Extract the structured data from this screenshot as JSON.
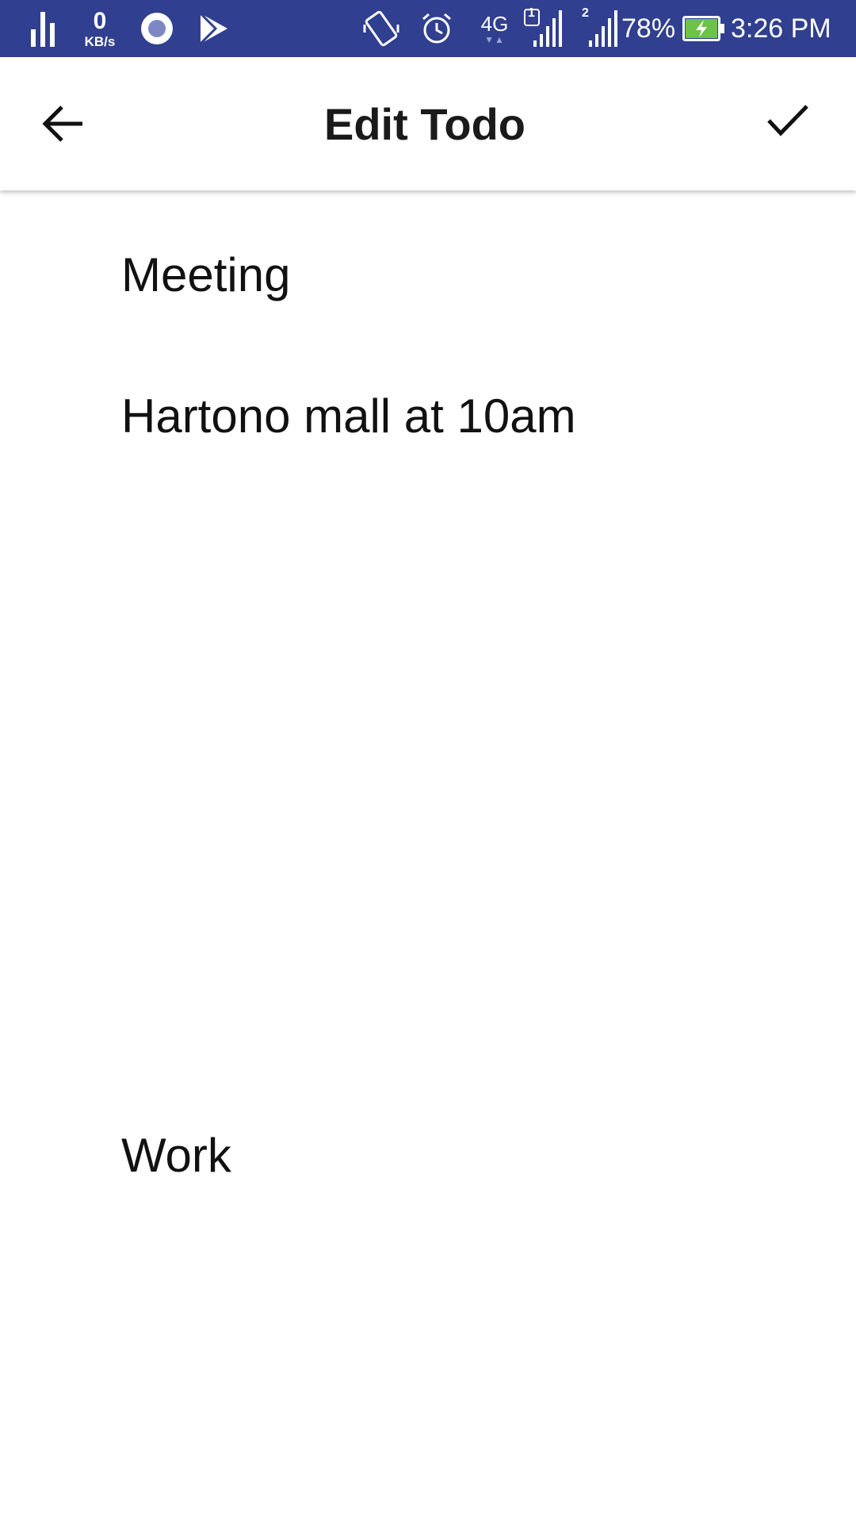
{
  "status_bar": {
    "data_speed_value": "0",
    "data_speed_unit": "KB/s",
    "network_type": "4G",
    "sim1_label": "1",
    "sim2_label": "2",
    "battery_percent": "78%",
    "time": "3:26 PM",
    "background_color": "#303f8f",
    "icons": [
      "signal-bars-icon",
      "circle-app-icon",
      "play-store-icon",
      "rotate-icon",
      "alarm-icon",
      "sim1-signal-icon",
      "sim2-signal-icon",
      "battery-charging-icon"
    ]
  },
  "app_bar": {
    "title": "Edit Todo",
    "back_icon": "arrow-back-icon",
    "confirm_icon": "checkmark-icon"
  },
  "form": {
    "title_value": "Meeting",
    "description_value": "Hartono mall at 10am",
    "category_value": "Work"
  }
}
